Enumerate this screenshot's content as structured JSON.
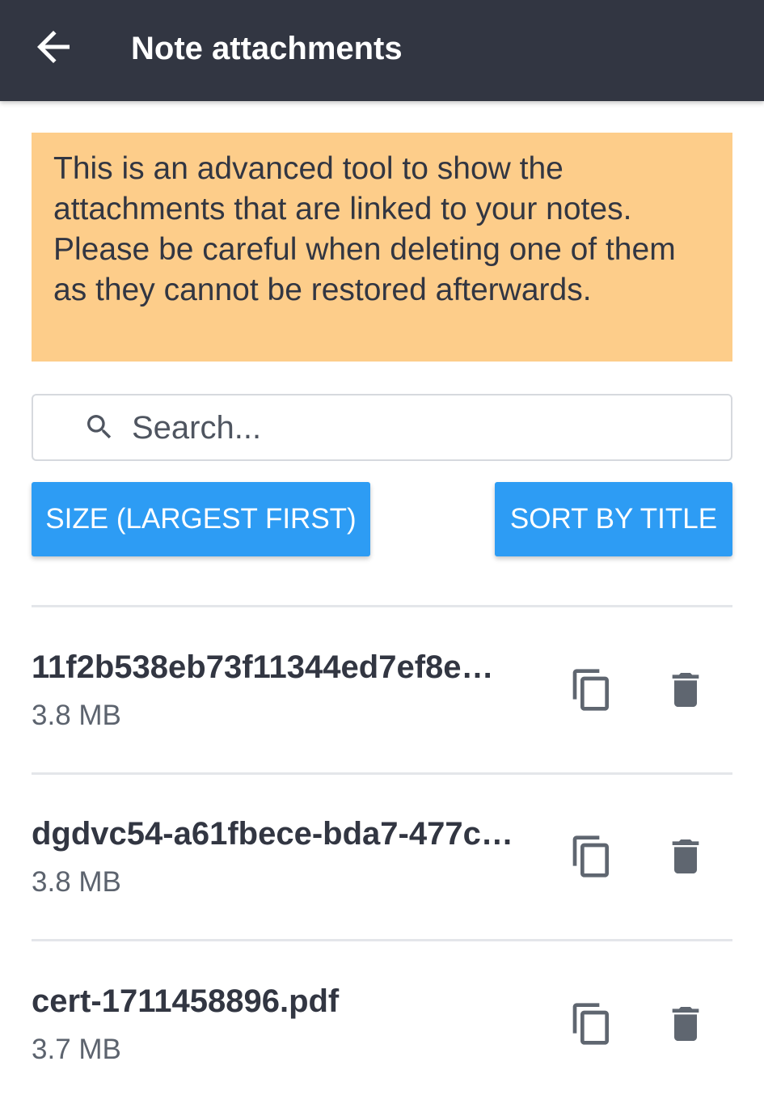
{
  "header": {
    "title": "Note attachments",
    "back_icon": "arrow-left-icon"
  },
  "notice": {
    "text": "This is an advanced tool to show the attachments that are linked to your notes. Please be careful when deleting one of them as they cannot be restored afterwards."
  },
  "search": {
    "placeholder": "Search...",
    "value": "",
    "icon": "search-icon"
  },
  "sort_buttons": {
    "size_label": "SIZE (LARGEST FIRST)",
    "title_label": "SORT BY TITLE"
  },
  "attachments": [
    {
      "name": "11f2b538eb73f11344ed7ef8e…",
      "size": "3.8 MB"
    },
    {
      "name": "dgdvc54-a61fbece-bda7-477c…",
      "size": "3.8 MB"
    },
    {
      "name": "cert-1711458896.pdf",
      "size": "3.7 MB"
    }
  ],
  "colors": {
    "header_bg": "#323642",
    "notice_bg": "#fdcd8a",
    "button_bg": "#2d9cf4",
    "icon_gray": "#5f6670",
    "text_dark": "#323642"
  }
}
